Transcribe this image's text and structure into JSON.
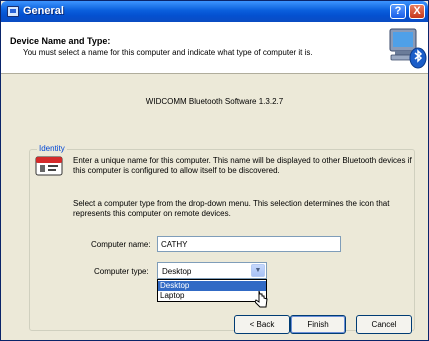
{
  "window": {
    "title": "General",
    "help_label": "?",
    "close_label": "X"
  },
  "header": {
    "title": "Device Name and Type:",
    "subtitle": "You must select a name for this computer and indicate what type of computer it is."
  },
  "version_text": "WIDCOMM Bluetooth Software 1.3.2.7",
  "identity": {
    "group_label": "Identity",
    "paragraph1": "Enter a unique name for this computer.  This name will be displayed to other Bluetooth devices if this computer is configured to allow itself to be discovered.",
    "paragraph2": "Select a computer type from the drop-down menu.  This selection determines the icon that represents this computer on remote devices.",
    "computer_name_label": "Computer name:",
    "computer_name_value": "CATHY",
    "computer_type_label": "Computer type:",
    "computer_type_value": "Desktop",
    "options": [
      "Desktop",
      "Laptop"
    ]
  },
  "buttons": {
    "back": "< Back",
    "finish": "Finish",
    "cancel": "Cancel"
  },
  "icons": {
    "title": "window-icon",
    "wizard": "computer-bluetooth-icon",
    "info": "id-card-icon",
    "dropdown": "chevron-down-icon",
    "cursor": "mouse-pointer-icon"
  },
  "colors": {
    "titlebar": "#0a5fdc",
    "selection": "#316ac5",
    "group_label": "#0046d5"
  }
}
